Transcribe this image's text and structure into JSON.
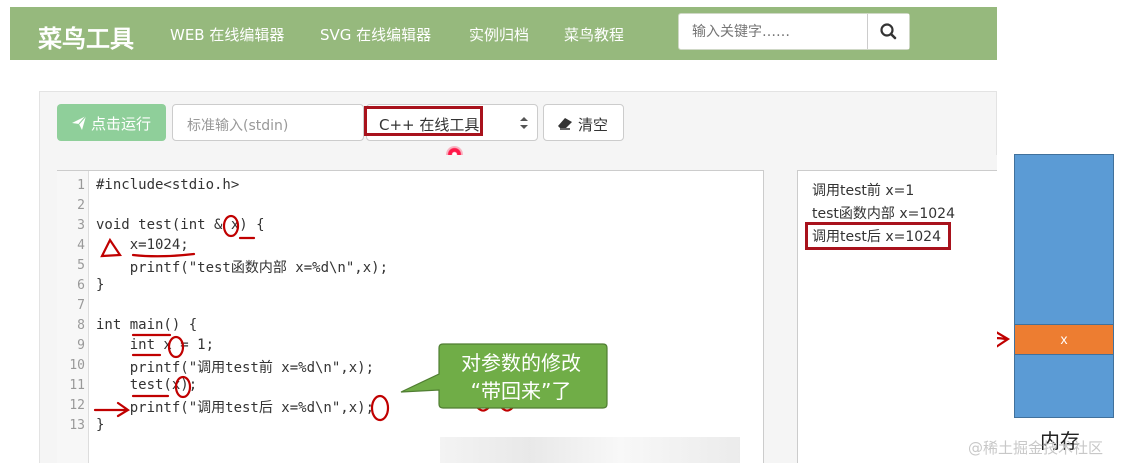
{
  "header": {
    "logo": "菜鸟工具",
    "nav": [
      "WEB 在线编辑器",
      "SVG 在线编辑器",
      "实例归档",
      "菜鸟教程"
    ],
    "search_placeholder": "输入关键字……",
    "search_icon": "search-icon",
    "background": "#96b97d"
  },
  "toolbar": {
    "run_label": "点击运行",
    "run_icon": "send-icon",
    "stdin_placeholder": "标准输入(stdin)",
    "language_selected": "C++ 在线工具",
    "clear_label": "清空",
    "clear_icon": "eraser-icon"
  },
  "editor": {
    "line_numbers": [
      "1",
      "2",
      "3",
      "4",
      "5",
      "6",
      "7",
      "8",
      "9",
      "10",
      "11",
      "12",
      "13"
    ],
    "lines": [
      "#include<stdio.h>",
      "",
      "void test(int & x) {",
      "    x=1024;",
      "    printf(\"test函数内部 x=%d\\n\",x);",
      "}",
      "",
      "int main() {",
      "    int x = 1;",
      "    printf(\"调用test前 x=%d\\n\",x);",
      "    test(x);",
      "    printf(\"调用test后 x=%d\\n\",x);",
      "}"
    ]
  },
  "output": {
    "lines": [
      "调用test前 x=1",
      "test函数内部 x=1024",
      "调用test后 x=1024"
    ]
  },
  "callout": {
    "line1": "对参数的修改",
    "line2": "“带回来”了",
    "color": "#70ad47"
  },
  "memory": {
    "cell_label": "x",
    "caption": "内存",
    "block_color": "#5b9bd5",
    "cell_color": "#ed7d31"
  },
  "watermark": "@稀土掘金技术社区",
  "annotation_color": "#c00000"
}
